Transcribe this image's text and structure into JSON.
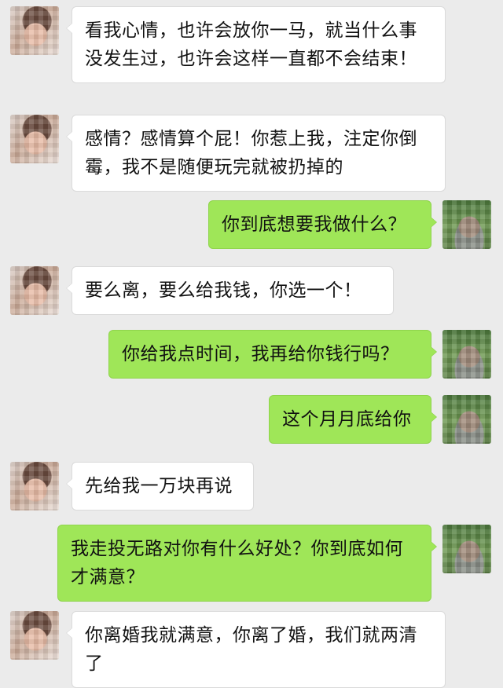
{
  "colors": {
    "background": "#ebebeb",
    "incoming_bubble": "#ffffff",
    "outgoing_bubble": "#9fe658"
  },
  "messages": [
    {
      "side": "left",
      "text": "看我心情，也许会放你一马，就当什么事没发生过，也许会这样一直都不会结束！"
    },
    {
      "side": "left",
      "text": "感情？感情算个屁！你惹上我，注定你倒霉，我不是随便玩完就被扔掉的"
    },
    {
      "side": "right",
      "text": "你到底想要我做什么？"
    },
    {
      "side": "left",
      "text": "要么离，要么给我钱，你选一个！"
    },
    {
      "side": "right",
      "text": "你给我点时间，我再给你钱行吗？"
    },
    {
      "side": "right",
      "text": "这个月月底给你"
    },
    {
      "side": "left",
      "text": "先给我一万块再说"
    },
    {
      "side": "right",
      "text": "我走投无路对你有什么好处？你到底如何才满意？"
    },
    {
      "side": "left",
      "text": "你离婚我就满意，你离了婚，我们就两清了"
    }
  ]
}
